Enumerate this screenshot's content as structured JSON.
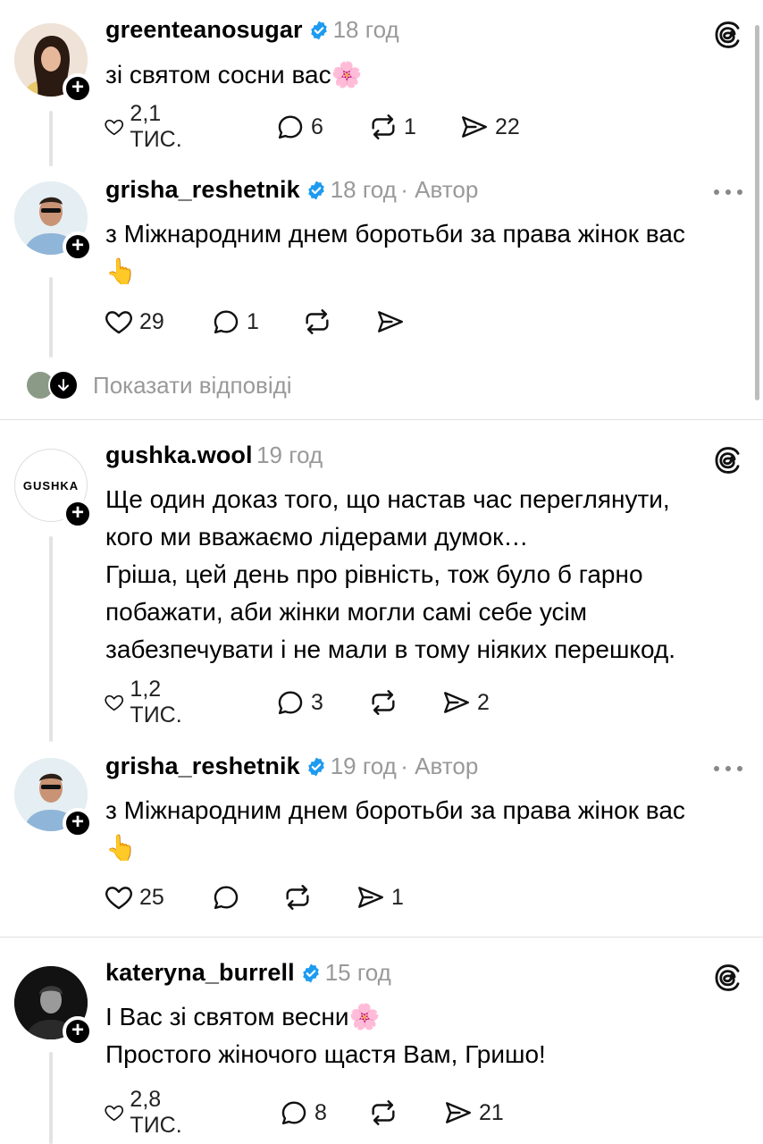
{
  "posts": [
    {
      "username": "greenteanosugar",
      "time": "18 год",
      "author_tag": "",
      "text_lines": [
        "зі святом сосни вас🌸"
      ],
      "likes": "2,1 ТИС.",
      "replies": "6",
      "reposts": "1",
      "shares": "22",
      "corner_icon": "threads-logo-icon"
    },
    {
      "username": "grisha_reshetnik",
      "time": "18 год",
      "author_tag": "· Автор",
      "text_lines": [
        "з Міжнародним днем боротьби за права жінок вас",
        "👆"
      ],
      "likes": "29",
      "replies": "1",
      "reposts": "",
      "shares": "",
      "corner_icon": "more-options-icon"
    },
    {
      "username": "gushka.wool",
      "time": "19 год",
      "author_tag": "",
      "text_lines": [
        "Ще один доказ того, що настав час переглянути,",
        "кого ми вважаємо лідерами думок…",
        "Гріша, цей день про рівність, тож було б гарно",
        "побажати, аби жінки могли самі себе усім",
        "забезпечувати і не мали в тому ніяких перешкод."
      ],
      "avatar_text": "GUSHKA",
      "likes": "1,2 ТИС.",
      "replies": "3",
      "reposts": "",
      "shares": "2",
      "corner_icon": "threads-logo-icon"
    },
    {
      "username": "grisha_reshetnik",
      "time": "19 год",
      "author_tag": "· Автор",
      "text_lines": [
        "з Міжнародним днем боротьби за права жінок вас",
        "👆"
      ],
      "likes": "25",
      "replies": "",
      "reposts": "",
      "shares": "1",
      "corner_icon": "more-options-icon"
    },
    {
      "username": "kateryna_burrell",
      "time": "15 год",
      "author_tag": "",
      "text_lines": [
        "І Вас зі святом весни🌸",
        "Простого жіночого щастя Вам, Гришо!"
      ],
      "likes": "2,8 ТИС.",
      "replies": "8",
      "reposts": "",
      "shares": "21",
      "corner_icon": "threads-logo-icon"
    }
  ],
  "show_replies": "Показати відповіді",
  "colors": {
    "verified": "#1d9bf0",
    "muted": "#999999",
    "divider": "#e0e0e0"
  }
}
